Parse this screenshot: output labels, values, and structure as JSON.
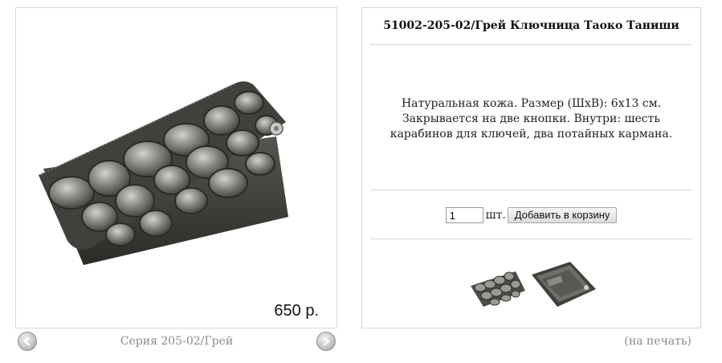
{
  "product": {
    "title": "51002-205-02/Грей Ключница Таоко Таниши",
    "description": "Натуральная кожа. Размер (ШхВ): 6х13 см. Закрывается на две кнопки. Внутри: шесть карабинов для ключей, два потайных кармана.",
    "price": "650 р."
  },
  "gallery": {
    "series_label": "Серия 205-02/Грей",
    "prev_icon": "arrow-left-icon",
    "next_icon": "arrow-right-icon"
  },
  "cart": {
    "quantity": "1",
    "unit": "шт.",
    "add_button": "Добавить в корзину"
  },
  "print_link": "(на печать)"
}
